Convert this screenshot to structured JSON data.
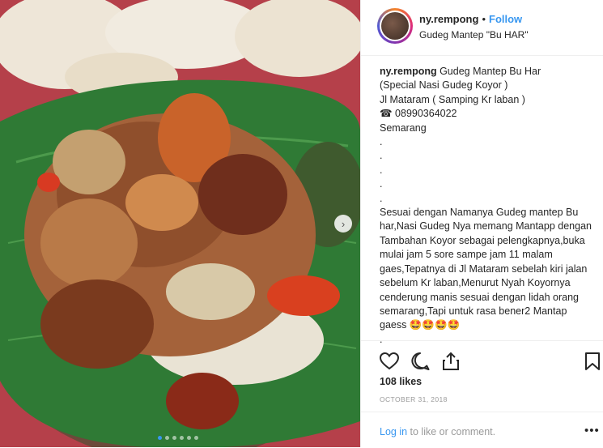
{
  "post": {
    "username": "ny.rempong",
    "separator": "•",
    "follow_label": "Follow",
    "location": "Gudeg Mantep \"Bu HAR\"",
    "caption_title": " Gudeg Mantep Bu Har",
    "caption_lines": [
      "(Special Nasi Gudeg Koyor )",
      "Jl Mataram ( Samping Kr laban )",
      "☎ 08990364022",
      "Semarang",
      ".",
      ".",
      ".",
      ".",
      "."
    ],
    "caption_body": "Sesuai dengan Namanya Gudeg mantep Bu har,Nasi Gudeg Nya memang Mantapp dengan Tambahan Koyor sebagai pelengkapnya,buka mulai jam 5 sore sampe jam 11 malam gaes,Tepatnya di Jl Mataram sebelah kiri jalan sebelum Kr laban,Menurut Nyah Koyornya cenderung manis sesuai dengan lidah orang semarang,Tapi untuk rasa bener2 Mantap gaess 🤩🤩🤩🤩",
    "caption_end": ".",
    "likes": "108 likes",
    "date": "OCTOBER 31, 2018",
    "login_link": "Log in",
    "login_rest": " to like or comment.",
    "more_label": "•••",
    "carousel_next": "›",
    "carousel_total": 6,
    "carousel_active_index": 0
  },
  "icons": {
    "like": "heart-outline-icon",
    "comment": "comment-bubble-icon",
    "share": "share-upload-icon",
    "save": "bookmark-icon"
  },
  "colors": {
    "link_blue": "#3897f0",
    "muted_gray": "#999999",
    "text": "#262626"
  }
}
